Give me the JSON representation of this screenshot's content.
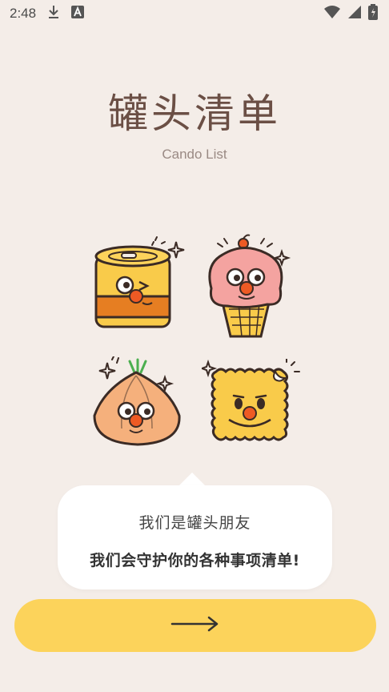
{
  "status_bar": {
    "time": "2:48",
    "icons": [
      "download-icon",
      "text-a-icon",
      "wifi-icon",
      "signal-icon",
      "battery-icon"
    ]
  },
  "app": {
    "title": "罐头清单",
    "subtitle": "Cando List"
  },
  "mascots": [
    "can-mascot",
    "ice-cream-mascot",
    "onion-mascot",
    "biscuit-mascot"
  ],
  "bubble": {
    "line1": "我们是罐头朋友",
    "line2": "我们会守护你的各种事项清单!"
  },
  "next_button": {
    "icon": "arrow-right-icon"
  },
  "colors": {
    "background": "#f4ede8",
    "accent_yellow": "#fcd35b",
    "nose_red": "#ee5a24",
    "title_brown": "#6b4f45"
  }
}
